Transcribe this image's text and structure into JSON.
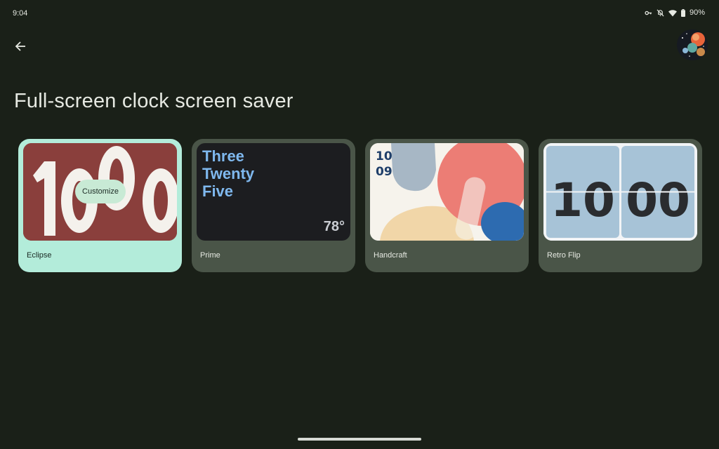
{
  "status_bar": {
    "time": "9:04",
    "battery": "90%",
    "icons": [
      "key-icon",
      "alarm-off-icon",
      "wifi-icon",
      "battery-icon"
    ]
  },
  "header": {
    "back_icon": "arrow-back-icon",
    "avatar": "avatar"
  },
  "page": {
    "title": "Full-screen clock screen saver"
  },
  "cards": [
    {
      "label": "Eclipse",
      "selected": true,
      "customize_label": "Customize",
      "clock_digits": "1000"
    },
    {
      "label": "Prime",
      "selected": false,
      "time_lines": [
        "Three",
        "Twenty",
        "Five"
      ],
      "temperature": "78°"
    },
    {
      "label": "Handcraft",
      "selected": false,
      "hour": "10",
      "minute": "09"
    },
    {
      "label": "Retro Flip",
      "selected": false,
      "hour": "10",
      "minute": "00"
    }
  ],
  "colors": {
    "background": "#1a2018",
    "card": "#4a5548",
    "card_selected": "#b3ecda",
    "prime_text": "#7fb8ee"
  }
}
